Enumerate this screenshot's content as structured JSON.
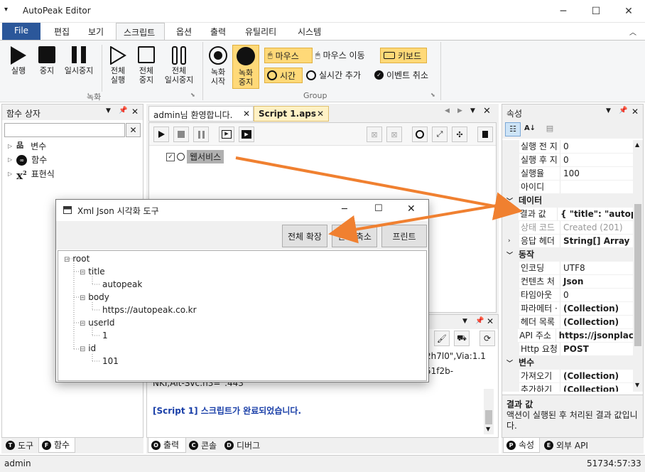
{
  "window": {
    "title": "AutoPeak Editor"
  },
  "ribbon_tabs": [
    "File",
    "편집",
    "보기",
    "스크립트",
    "옵션",
    "출력",
    "유틸리티",
    "시스템"
  ],
  "ribbon": {
    "record_group": {
      "label": "녹화",
      "run": "실행",
      "stop": "중지",
      "pause": "일시중지",
      "run_all_1": "전체",
      "run_all_2": "실행",
      "stop_all_1": "전체",
      "stop_all_2": "중지",
      "pause_all_1": "전체",
      "pause_all_2": "일시중지"
    },
    "group2": {
      "label": "Group",
      "rec_start_1": "녹화",
      "rec_start_2": "시작",
      "rec_stop_1": "녹화",
      "rec_stop_2": "중지",
      "mouse": "마우스",
      "mouse_move": "마우스 이동",
      "keyboard": "키보드",
      "time": "시간",
      "realtime_add": "실시간 추가",
      "event_cancel": "이벤트 취소"
    }
  },
  "left_pane": {
    "title": "함수 상자",
    "items": [
      {
        "label": "변수",
        "icon": "variable-icon"
      },
      {
        "label": "함수",
        "icon": "function-icon"
      },
      {
        "label": "표현식",
        "icon": "expression-icon"
      }
    ],
    "tabs": [
      "도구",
      "함수"
    ]
  },
  "doc_tabs": [
    "admin님 환영합니다.",
    "Script 1.aps"
  ],
  "script_node": {
    "label": "웹서비스"
  },
  "output": {
    "line1": "2h7l0\",Via:1.1",
    "line2": "51f2b-",
    "line3": "NKI,Alt-Svc:h3=\":443\"",
    "complete_prefix": "[Script 1]",
    "complete_msg": "스크립트가 완료되었습니다.",
    "tabs": [
      "출력",
      "콘솔",
      "디버그"
    ]
  },
  "dialog": {
    "title": "Xml Json 시각화 도구",
    "buttons": [
      "전체 확장",
      "전체 축소",
      "프린트"
    ],
    "tree": {
      "root": "root",
      "title_key": "title",
      "title_val": "autopeak",
      "body_key": "body",
      "body_val": "https://autopeak.co.kr",
      "userId_key": "userId",
      "userId_val": "1",
      "id_key": "id",
      "id_val": "101"
    }
  },
  "properties": {
    "title": "속성",
    "rows": [
      {
        "name": "실행 전 지",
        "value": "0",
        "bold": false
      },
      {
        "name": "실행 후 지",
        "value": "0",
        "bold": false
      },
      {
        "name": "실행율",
        "value": "100",
        "bold": false
      },
      {
        "name": "아이디",
        "value": "",
        "bold": false
      }
    ],
    "cat_data": "데이터",
    "data_rows": [
      {
        "name": "결과 값",
        "value": "{  \"title\": \"autop",
        "bold": true
      },
      {
        "name": "상태 코드",
        "value": "Created (201)",
        "bold": false,
        "grey": true
      },
      {
        "name": "응답 헤더",
        "value": "String[] Array",
        "bold": true
      }
    ],
    "cat_action": "동작",
    "action_rows": [
      {
        "name": "인코딩",
        "value": "UTF8",
        "bold": false
      },
      {
        "name": "컨텐츠 처",
        "value": "Json",
        "bold": true
      },
      {
        "name": "타임아웃",
        "value": "0",
        "bold": false
      },
      {
        "name": "파라메터 ·",
        "value": "(Collection)",
        "bold": true
      },
      {
        "name": "헤더 목록",
        "value": "(Collection)",
        "bold": true
      },
      {
        "name": "API 주소",
        "value": "https://jsonplace",
        "bold": true
      },
      {
        "name": "Http 요청",
        "value": "POST",
        "bold": true
      }
    ],
    "cat_var": "변수",
    "var_rows": [
      {
        "name": "가져오기",
        "value": "(Collection)",
        "bold": true
      },
      {
        "name": "추가하기",
        "value": "(Collection)",
        "bold": true
      }
    ],
    "desc_title": "결과 값",
    "desc_text": "액션이 실행된 후 처리된 결과 값입니다.",
    "tabs": [
      "속성",
      "외부 API"
    ]
  },
  "status": {
    "left": "admin",
    "right": "51734:57:33"
  },
  "colors": {
    "accent": "#2b579a",
    "arrow": "#f08030",
    "highlight": "#ffd978"
  }
}
